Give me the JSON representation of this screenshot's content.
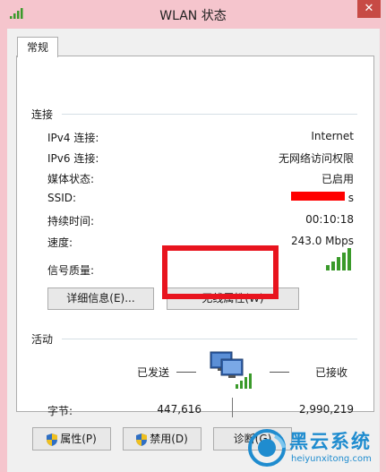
{
  "window": {
    "title": "WLAN 状态",
    "close_glyph": "✕"
  },
  "tabs": [
    {
      "label": "常规"
    }
  ],
  "connection": {
    "section_label": "连接",
    "rows": [
      {
        "label": "IPv4 连接:",
        "value": "Internet"
      },
      {
        "label": "IPv6 连接:",
        "value": "无网络访问权限"
      },
      {
        "label": "媒体状态:",
        "value": "已启用"
      },
      {
        "label": "SSID:",
        "value": "s"
      },
      {
        "label": "持续时间:",
        "value": "00:10:18"
      },
      {
        "label": "速度:",
        "value": "243.0 Mbps"
      }
    ],
    "signal_label": "信号质量:",
    "signal_bars": 5,
    "signal_max": 5
  },
  "buttons": {
    "details": "详细信息(E)...",
    "wireless_props": "无线属性(W)"
  },
  "activity": {
    "section_label": "活动",
    "sent_label": "已发送",
    "received_label": "已接收",
    "bytes_label": "字节:",
    "bytes_sent": "447,616",
    "bytes_received": "2,990,219"
  },
  "bottom_buttons": {
    "properties": "属性(P)",
    "disable": "禁用(D)",
    "diagnose": "诊断(G)"
  },
  "watermark": {
    "name": "黑云系统",
    "url": "heiyunxitong.com"
  },
  "colors": {
    "titlebar": "#f5c5cd",
    "close": "#c74a45",
    "highlight": "#e8141e",
    "signal": "#3a9a2a",
    "watermark_blue": "#1f8ccf"
  }
}
